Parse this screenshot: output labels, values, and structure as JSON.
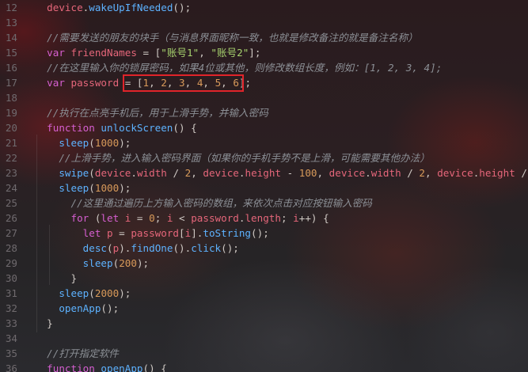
{
  "editor": {
    "lines": [
      {
        "n": "12",
        "tokens": [
          [
            "pun",
            "  "
          ],
          [
            "var",
            "device"
          ],
          [
            "pun",
            "."
          ],
          [
            "fn",
            "wakeUpIfNeeded"
          ],
          [
            "pun",
            "();"
          ]
        ]
      },
      {
        "n": "13",
        "tokens": []
      },
      {
        "n": "14",
        "tokens": [
          [
            "cm",
            "  //需要发送的朋友的块手（与消息界面昵称一致，也就是修改备注的就是备注名称）"
          ]
        ]
      },
      {
        "n": "15",
        "tokens": [
          [
            "kw",
            "  var "
          ],
          [
            "var",
            "friendNames"
          ],
          [
            "pun",
            " = ["
          ],
          [
            "str",
            "\"账号1\""
          ],
          [
            "pun",
            ", "
          ],
          [
            "str",
            "\"账号2\""
          ],
          [
            "pun",
            "];"
          ]
        ]
      },
      {
        "n": "16",
        "tokens": [
          [
            "cm",
            "  //在这里输入你的锁屏密码，如果4位或其他，则修改数组长度，例如：[1, 2, 3, 4];"
          ]
        ]
      },
      {
        "n": "17",
        "tokens": [
          [
            "kw",
            "  var "
          ],
          [
            "var",
            "password"
          ],
          [
            "pun",
            " = ["
          ],
          [
            "num",
            "1"
          ],
          [
            "pun",
            ", "
          ],
          [
            "num",
            "2"
          ],
          [
            "pun",
            ", "
          ],
          [
            "num",
            "3"
          ],
          [
            "pun",
            ", "
          ],
          [
            "num",
            "4"
          ],
          [
            "pun",
            ", "
          ],
          [
            "num",
            "5"
          ],
          [
            "pun",
            ", "
          ],
          [
            "num",
            "6"
          ],
          [
            "pun",
            "];"
          ]
        ]
      },
      {
        "n": "18",
        "tokens": []
      },
      {
        "n": "19",
        "tokens": [
          [
            "cm",
            "  //执行在点亮手机后，用于上滑手势，并输入密码"
          ]
        ]
      },
      {
        "n": "20",
        "tokens": [
          [
            "kw",
            "  function "
          ],
          [
            "fn",
            "unlockScreen"
          ],
          [
            "pun",
            "() {"
          ]
        ]
      },
      {
        "n": "21",
        "tokens": [
          [
            "pun",
            "    "
          ],
          [
            "fn",
            "sleep"
          ],
          [
            "pun",
            "("
          ],
          [
            "num",
            "1000"
          ],
          [
            "pun",
            ");"
          ]
        ]
      },
      {
        "n": "22",
        "tokens": [
          [
            "cm",
            "    //上滑手势，进入输入密码界面（如果你的手机手势不是上滑，可能需要其他办法）"
          ]
        ]
      },
      {
        "n": "23",
        "tokens": [
          [
            "pun",
            "    "
          ],
          [
            "fn",
            "swipe"
          ],
          [
            "pun",
            "("
          ],
          [
            "var",
            "device"
          ],
          [
            "pun",
            "."
          ],
          [
            "var",
            "width"
          ],
          [
            "pun",
            " / "
          ],
          [
            "num",
            "2"
          ],
          [
            "pun",
            ", "
          ],
          [
            "var",
            "device"
          ],
          [
            "pun",
            "."
          ],
          [
            "var",
            "height"
          ],
          [
            "pun",
            " - "
          ],
          [
            "num",
            "100"
          ],
          [
            "pun",
            ", "
          ],
          [
            "var",
            "device"
          ],
          [
            "pun",
            "."
          ],
          [
            "var",
            "width"
          ],
          [
            "pun",
            " / "
          ],
          [
            "num",
            "2"
          ],
          [
            "pun",
            ", "
          ],
          [
            "var",
            "device"
          ],
          [
            "pun",
            "."
          ],
          [
            "var",
            "height"
          ],
          [
            "pun",
            " /"
          ]
        ]
      },
      {
        "n": "24",
        "tokens": [
          [
            "pun",
            "    "
          ],
          [
            "fn",
            "sleep"
          ],
          [
            "pun",
            "("
          ],
          [
            "num",
            "1000"
          ],
          [
            "pun",
            ");"
          ]
        ]
      },
      {
        "n": "25",
        "tokens": [
          [
            "cm",
            "      //这里通过遍历上方输入密码的数组，来依次点击对应按钮输入密码"
          ]
        ]
      },
      {
        "n": "26",
        "tokens": [
          [
            "kw",
            "      for"
          ],
          [
            "pun",
            " ("
          ],
          [
            "kw",
            "let"
          ],
          [
            "var",
            " i"
          ],
          [
            "pun",
            " = "
          ],
          [
            "num",
            "0"
          ],
          [
            "pun",
            "; "
          ],
          [
            "var",
            "i"
          ],
          [
            "pun",
            " < "
          ],
          [
            "var",
            "password"
          ],
          [
            "pun",
            "."
          ],
          [
            "var",
            "length"
          ],
          [
            "pun",
            "; "
          ],
          [
            "var",
            "i"
          ],
          [
            "pun",
            "++) {"
          ]
        ]
      },
      {
        "n": "27",
        "tokens": [
          [
            "kw",
            "        let"
          ],
          [
            "var",
            " p"
          ],
          [
            "pun",
            " = "
          ],
          [
            "var",
            "password"
          ],
          [
            "pun",
            "["
          ],
          [
            "var",
            "i"
          ],
          [
            "pun",
            "]."
          ],
          [
            "fn",
            "toString"
          ],
          [
            "pun",
            "();"
          ]
        ]
      },
      {
        "n": "28",
        "tokens": [
          [
            "pun",
            "        "
          ],
          [
            "fn",
            "desc"
          ],
          [
            "pun",
            "("
          ],
          [
            "var",
            "p"
          ],
          [
            "pun",
            ")."
          ],
          [
            "fn",
            "findOne"
          ],
          [
            "pun",
            "()."
          ],
          [
            "fn",
            "click"
          ],
          [
            "pun",
            "();"
          ]
        ]
      },
      {
        "n": "29",
        "tokens": [
          [
            "pun",
            "        "
          ],
          [
            "fn",
            "sleep"
          ],
          [
            "pun",
            "("
          ],
          [
            "num",
            "200"
          ],
          [
            "pun",
            ");"
          ]
        ]
      },
      {
        "n": "30",
        "tokens": [
          [
            "pun",
            "      }"
          ]
        ]
      },
      {
        "n": "31",
        "tokens": [
          [
            "pun",
            "    "
          ],
          [
            "fn",
            "sleep"
          ],
          [
            "pun",
            "("
          ],
          [
            "num",
            "2000"
          ],
          [
            "pun",
            ");"
          ]
        ]
      },
      {
        "n": "32",
        "tokens": [
          [
            "pun",
            "    "
          ],
          [
            "fn",
            "openApp"
          ],
          [
            "pun",
            "();"
          ]
        ]
      },
      {
        "n": "33",
        "tokens": [
          [
            "pun",
            "  }"
          ]
        ]
      },
      {
        "n": "34",
        "tokens": []
      },
      {
        "n": "35",
        "tokens": [
          [
            "cm",
            "  //打开指定软件"
          ]
        ]
      },
      {
        "n": "36",
        "tokens": [
          [
            "kw",
            "  function "
          ],
          [
            "fn",
            "openApp"
          ],
          [
            "pun",
            "() {"
          ]
        ]
      }
    ]
  },
  "colors": {
    "highlight_box": "#e0242a"
  }
}
